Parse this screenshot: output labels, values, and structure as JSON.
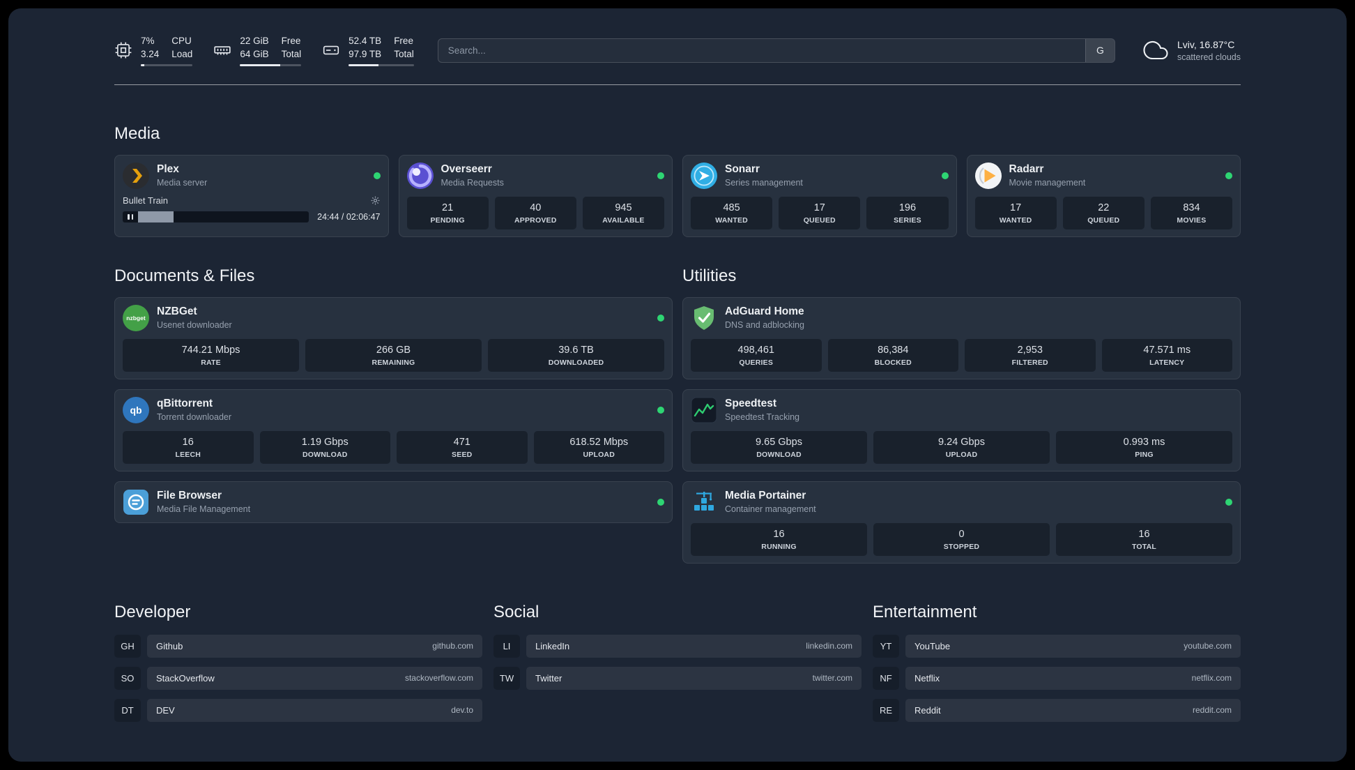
{
  "colors": {
    "page_bg": "#1c2534",
    "card_bg": "#27313f",
    "status_green": "#2ed573",
    "plex_amber": "#e5a00d"
  },
  "topbar": {
    "resources": [
      {
        "icon": "cpu-icon",
        "value_top": "7%",
        "value_bottom": "3.24",
        "label_top": "CPU",
        "label_bottom": "Load",
        "progress_percent": 7
      },
      {
        "icon": "memory-icon",
        "value_top": "22 GiB",
        "value_bottom": "64 GiB",
        "label_top": "Free",
        "label_bottom": "Total",
        "progress_percent": 66
      },
      {
        "icon": "disk-icon",
        "value_top": "52.4 TB",
        "value_bottom": "97.9 TB",
        "label_top": "Free",
        "label_bottom": "Total",
        "progress_percent": 46
      }
    ],
    "search": {
      "placeholder": "Search...",
      "engine_button": "G"
    },
    "weather": {
      "location": "Lviv, 16.87°C",
      "condition": "scattered clouds"
    }
  },
  "sections": {
    "media": {
      "title": "Media",
      "plex": {
        "name": "Plex",
        "desc": "Media server",
        "player": {
          "title": "Bullet Train",
          "time": "24:44 / 02:06:47",
          "progress_percent": 19
        }
      },
      "overseerr": {
        "name": "Overseerr",
        "desc": "Media Requests",
        "stats": [
          {
            "value": "21",
            "label": "PENDING"
          },
          {
            "value": "40",
            "label": "APPROVED"
          },
          {
            "value": "945",
            "label": "AVAILABLE"
          }
        ]
      },
      "sonarr": {
        "name": "Sonarr",
        "desc": "Series management",
        "stats": [
          {
            "value": "485",
            "label": "WANTED"
          },
          {
            "value": "17",
            "label": "QUEUED"
          },
          {
            "value": "196",
            "label": "SERIES"
          }
        ]
      },
      "radarr": {
        "name": "Radarr",
        "desc": "Movie management",
        "stats": [
          {
            "value": "17",
            "label": "WANTED"
          },
          {
            "value": "22",
            "label": "QUEUED"
          },
          {
            "value": "834",
            "label": "MOVIES"
          }
        ]
      }
    },
    "documents": {
      "title": "Documents & Files",
      "nzbget": {
        "name": "NZBGet",
        "desc": "Usenet downloader",
        "stats": [
          {
            "value": "744.21 Mbps",
            "label": "RATE"
          },
          {
            "value": "266 GB",
            "label": "REMAINING"
          },
          {
            "value": "39.6 TB",
            "label": "DOWNLOADED"
          }
        ]
      },
      "qbittorrent": {
        "name": "qBittorrent",
        "desc": "Torrent downloader",
        "stats": [
          {
            "value": "16",
            "label": "LEECH"
          },
          {
            "value": "1.19 Gbps",
            "label": "DOWNLOAD"
          },
          {
            "value": "471",
            "label": "SEED"
          },
          {
            "value": "618.52 Mbps",
            "label": "UPLOAD"
          }
        ]
      },
      "filebrowser": {
        "name": "File Browser",
        "desc": "Media File Management"
      }
    },
    "utilities": {
      "title": "Utilities",
      "adguard": {
        "name": "AdGuard Home",
        "desc": "DNS and adblocking",
        "stats": [
          {
            "value": "498,461",
            "label": "QUERIES"
          },
          {
            "value": "86,384",
            "label": "BLOCKED"
          },
          {
            "value": "2,953",
            "label": "FILTERED"
          },
          {
            "value": "47.571 ms",
            "label": "LATENCY"
          }
        ]
      },
      "speedtest": {
        "name": "Speedtest",
        "desc": "Speedtest Tracking",
        "stats": [
          {
            "value": "9.65 Gbps",
            "label": "DOWNLOAD"
          },
          {
            "value": "9.24 Gbps",
            "label": "UPLOAD"
          },
          {
            "value": "0.993 ms",
            "label": "PING"
          }
        ]
      },
      "portainer": {
        "name": "Media Portainer",
        "desc": "Container management",
        "stats": [
          {
            "value": "16",
            "label": "RUNNING"
          },
          {
            "value": "0",
            "label": "STOPPED"
          },
          {
            "value": "16",
            "label": "TOTAL"
          }
        ]
      }
    }
  },
  "bookmarks": [
    {
      "title": "Developer",
      "items": [
        {
          "abbr": "GH",
          "name": "Github",
          "domain": "github.com"
        },
        {
          "abbr": "SO",
          "name": "StackOverflow",
          "domain": "stackoverflow.com"
        },
        {
          "abbr": "DT",
          "name": "DEV",
          "domain": "dev.to"
        }
      ]
    },
    {
      "title": "Social",
      "items": [
        {
          "abbr": "LI",
          "name": "LinkedIn",
          "domain": "linkedin.com"
        },
        {
          "abbr": "TW",
          "name": "Twitter",
          "domain": "twitter.com"
        }
      ]
    },
    {
      "title": "Entertainment",
      "items": [
        {
          "abbr": "YT",
          "name": "YouTube",
          "domain": "youtube.com"
        },
        {
          "abbr": "NF",
          "name": "Netflix",
          "domain": "netflix.com"
        },
        {
          "abbr": "RE",
          "name": "Reddit",
          "domain": "reddit.com"
        }
      ]
    }
  ]
}
